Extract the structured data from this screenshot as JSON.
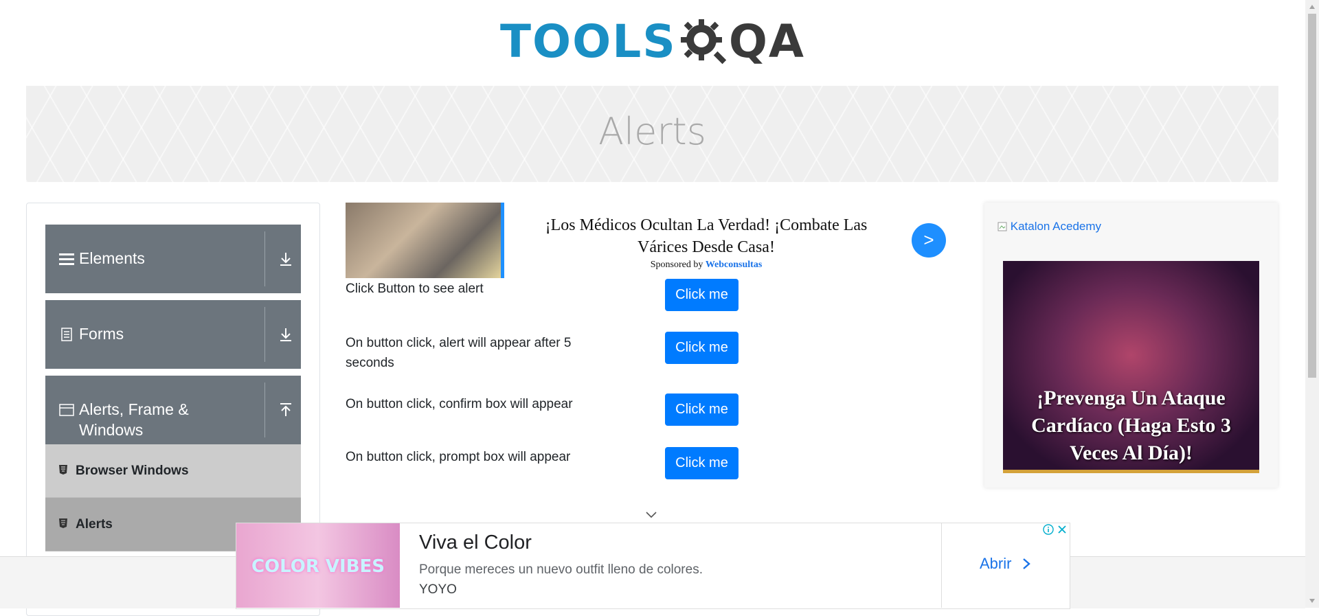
{
  "header": {
    "logo_text_left": "TOOLS",
    "logo_text_right": "QA",
    "page_title": "Alerts"
  },
  "sidebar": {
    "groups": [
      {
        "label": "Elements",
        "expanded": false,
        "icon": "hamburger-icon"
      },
      {
        "label": "Forms",
        "expanded": false,
        "icon": "document-icon"
      },
      {
        "label": "Alerts, Frame & Windows",
        "expanded": true,
        "icon": "window-icon"
      }
    ],
    "items": [
      {
        "label": "Browser Windows",
        "icon": "html5-icon",
        "active": false
      },
      {
        "label": "Alerts",
        "icon": "html5-icon",
        "active": true
      }
    ]
  },
  "ad_top": {
    "headline": "¡Los Médicos Ocultan La Verdad! ¡Combate Las Várices Desde Casa!",
    "sponsor_prefix": "Sponsored by",
    "sponsor_name": "Webconsultas",
    "next_label": ">"
  },
  "alerts": {
    "rows": [
      {
        "text": "Click Button to see alert",
        "button": "Click me"
      },
      {
        "text": "On button click, alert will appear after 5 seconds",
        "button": "Click me"
      },
      {
        "text": "On button click, confirm box will appear",
        "button": "Click me"
      },
      {
        "text": "On button click, prompt box will appear",
        "button": "Click me"
      }
    ]
  },
  "ad_right": {
    "link_text": "Katalon Acedemy",
    "headline": "¡Prevenga Un Ataque Cardíaco (Haga Esto 3 Veces Al Día)!"
  },
  "ad_bottom": {
    "image_text": "COLOR VIBES",
    "title": "Viva el Color",
    "description": "Porque mereces un nuevo outfit lleno de colores.",
    "brand": "YOYO",
    "cta": "Abrir"
  },
  "colors": {
    "primary": "#007bff",
    "sidebar_group": "#6c757d",
    "submenu_item": "#cccccc",
    "submenu_active": "#aaaaaa",
    "logo_blue": "#1a8fc4"
  }
}
